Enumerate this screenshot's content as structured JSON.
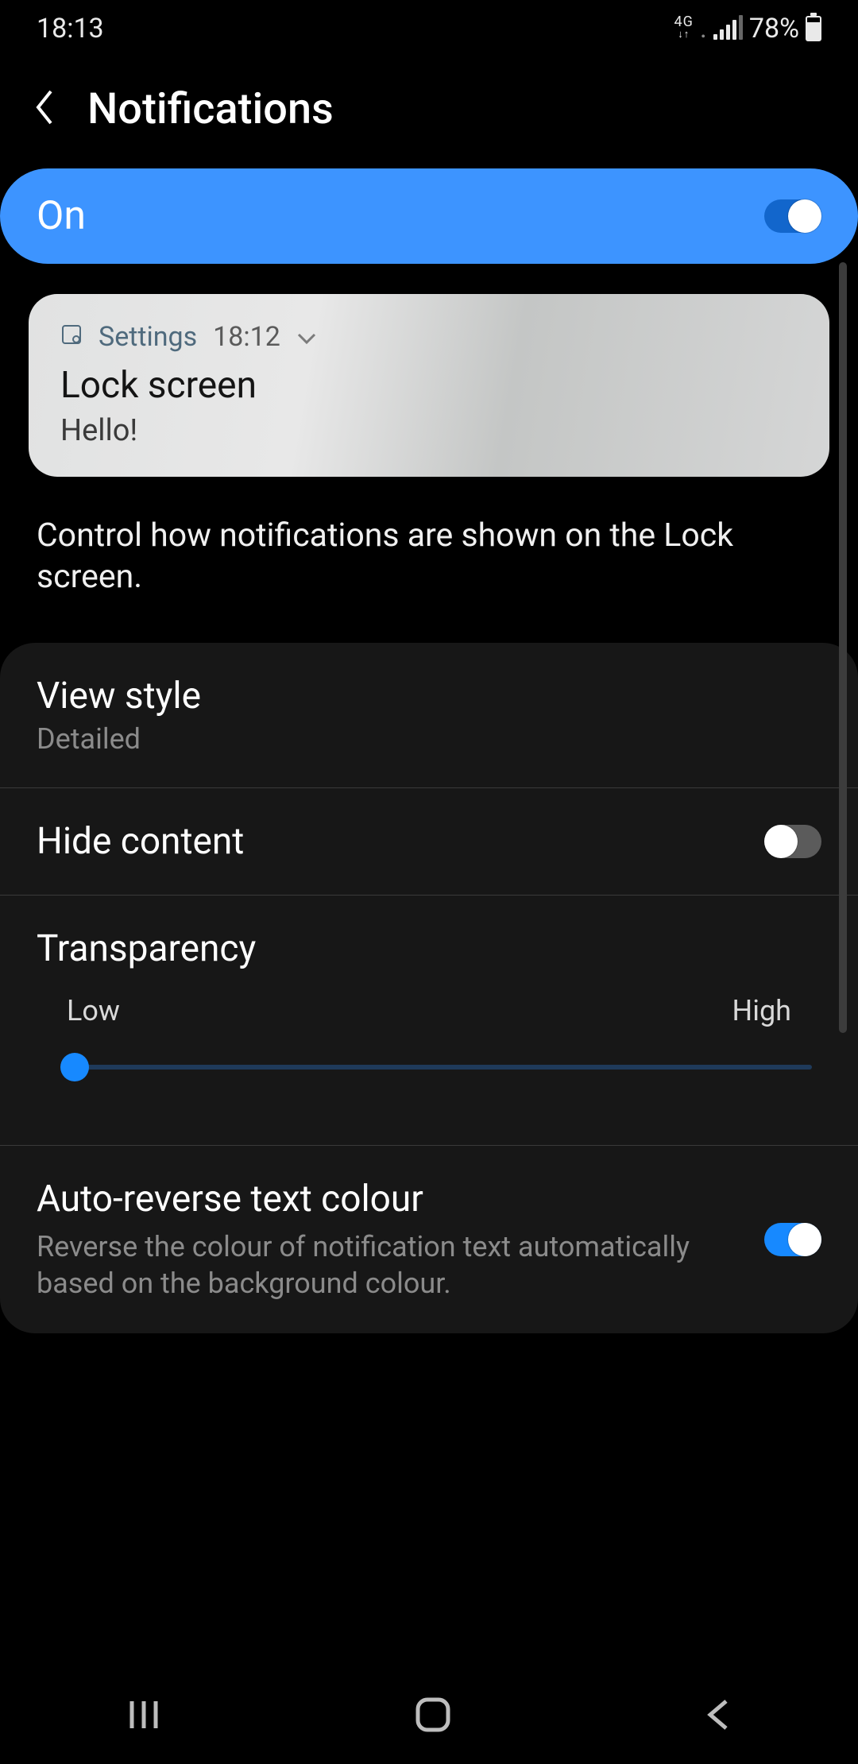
{
  "status": {
    "time": "18:13",
    "network": "4G",
    "battery": "78%"
  },
  "header": {
    "title": "Notifications"
  },
  "master": {
    "label": "On",
    "on": true
  },
  "preview": {
    "app": "Settings",
    "timestamp": "18:12",
    "title": "Lock screen",
    "body": "Hello!"
  },
  "description": "Control how notifications are shown on the Lock screen.",
  "settings": {
    "view_style": {
      "title": "View style",
      "value": "Detailed"
    },
    "hide_content": {
      "title": "Hide content",
      "on": false
    },
    "transparency": {
      "title": "Transparency",
      "low": "Low",
      "high": "High",
      "value": 0.03
    },
    "auto_reverse": {
      "title": "Auto-reverse text colour",
      "desc": "Reverse the colour of notification text automatically based on the background colour.",
      "on": true
    }
  }
}
